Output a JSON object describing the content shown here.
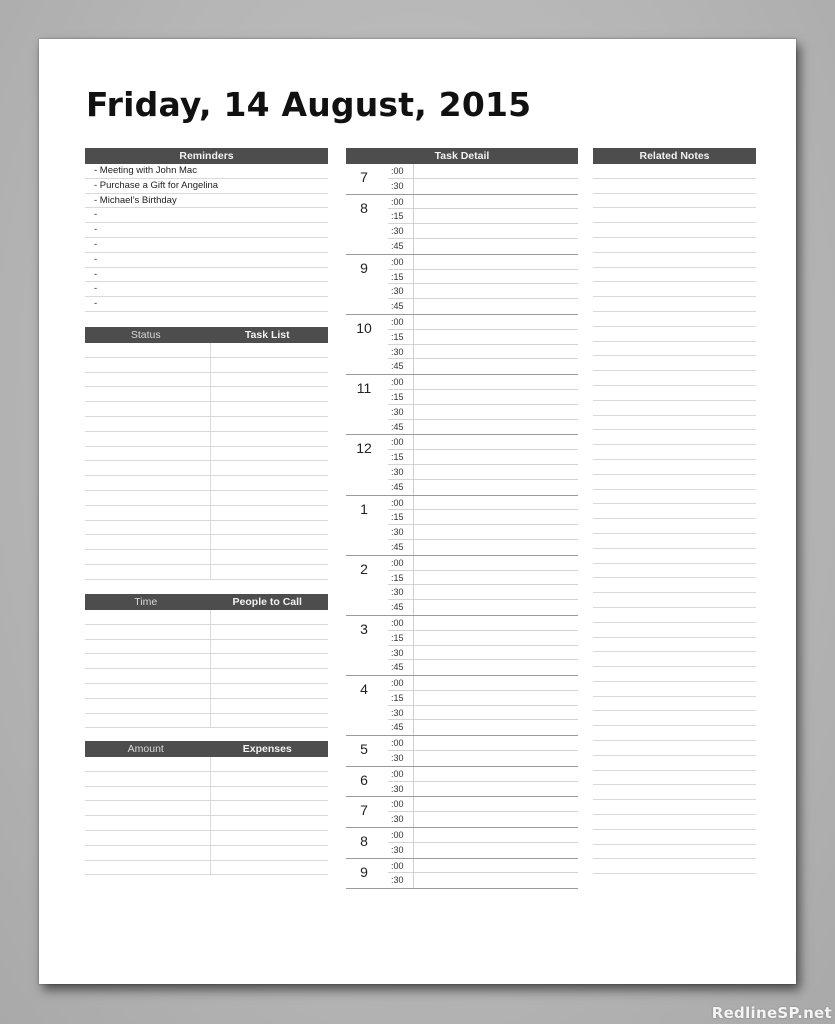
{
  "title": "Friday, 14 August, 2015",
  "reminders": {
    "header": "Reminders",
    "items": [
      "- Meeting with John Mac",
      "- Purchase a Gift for Angelina",
      "- Michael’s Birthday",
      "-",
      "-",
      "-",
      "-",
      "-",
      "-",
      "-"
    ]
  },
  "task_list": {
    "headers": [
      "Status",
      "Task List"
    ],
    "row_count": 16
  },
  "people_to_call": {
    "headers": [
      "Time",
      "People to Call"
    ],
    "row_count": 8
  },
  "expenses": {
    "headers": [
      "Amount",
      "Expenses"
    ],
    "row_count": 8
  },
  "task_detail": {
    "header": "Task Detail",
    "hours": [
      {
        "hour": "7",
        "slots": [
          ":00",
          ":30"
        ]
      },
      {
        "hour": "8",
        "slots": [
          ":00",
          ":15",
          ":30",
          ":45"
        ]
      },
      {
        "hour": "9",
        "slots": [
          ":00",
          ":15",
          ":30",
          ":45"
        ]
      },
      {
        "hour": "10",
        "slots": [
          ":00",
          ":15",
          ":30",
          ":45"
        ]
      },
      {
        "hour": "11",
        "slots": [
          ":00",
          ":15",
          ":30",
          ":45"
        ]
      },
      {
        "hour": "12",
        "slots": [
          ":00",
          ":15",
          ":30",
          ":45"
        ]
      },
      {
        "hour": "1",
        "slots": [
          ":00",
          ":15",
          ":30",
          ":45"
        ]
      },
      {
        "hour": "2",
        "slots": [
          ":00",
          ":15",
          ":30",
          ":45"
        ]
      },
      {
        "hour": "3",
        "slots": [
          ":00",
          ":15",
          ":30",
          ":45"
        ]
      },
      {
        "hour": "4",
        "slots": [
          ":00",
          ":15",
          ":30",
          ":45"
        ]
      },
      {
        "hour": "5",
        "slots": [
          ":00",
          ":30"
        ]
      },
      {
        "hour": "6",
        "slots": [
          ":00",
          ":30"
        ]
      },
      {
        "hour": "7",
        "slots": [
          ":00",
          ":30"
        ]
      },
      {
        "hour": "8",
        "slots": [
          ":00",
          ":30"
        ]
      },
      {
        "hour": "9",
        "slots": [
          ":00",
          ":30"
        ]
      }
    ]
  },
  "related_notes": {
    "header": "Related Notes",
    "row_count": 48
  },
  "watermark": "RedlineSP.net"
}
